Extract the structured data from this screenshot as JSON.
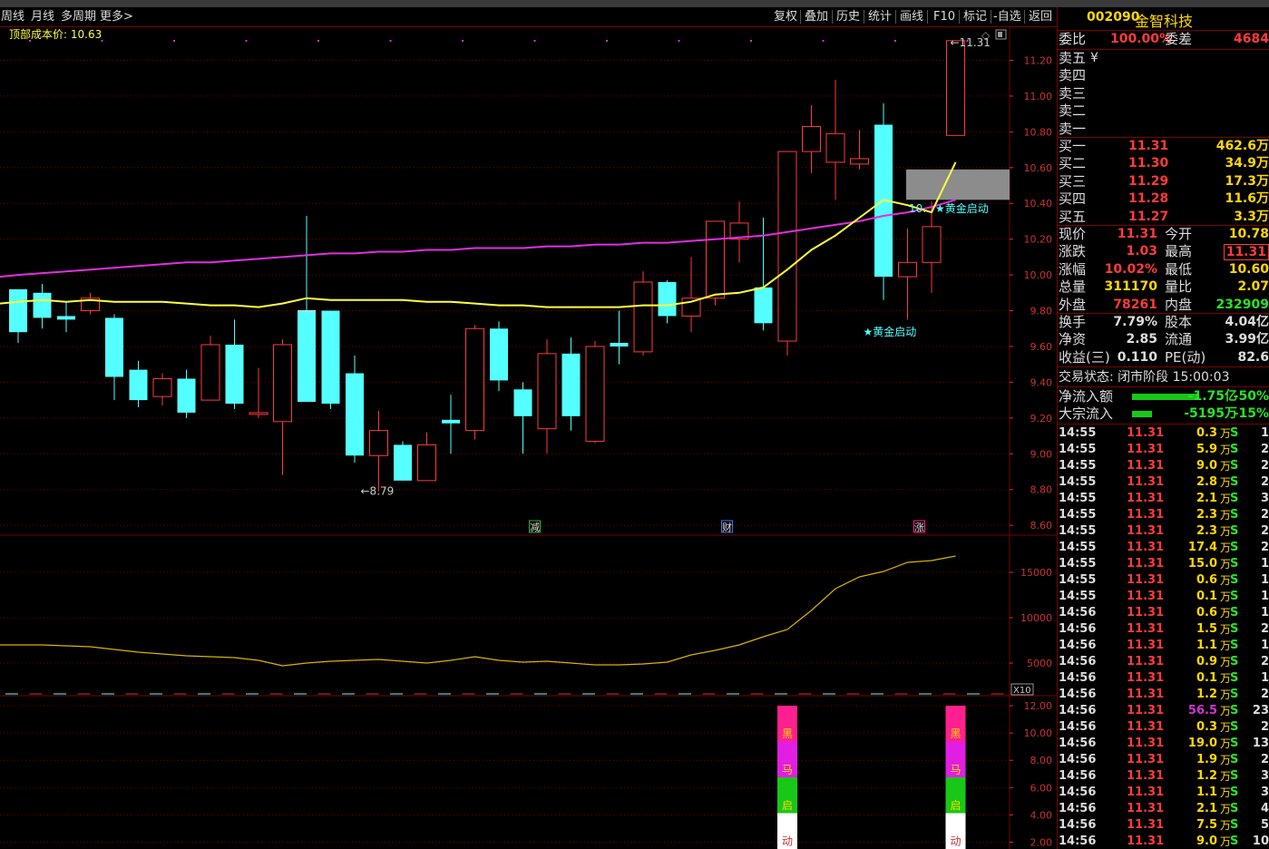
{
  "toolbar": {
    "left": [
      "周线",
      "月线",
      "多周期",
      "更多"
    ],
    "right": [
      "复权",
      "叠加",
      "历史",
      "统计",
      "画线",
      "F10",
      "标记",
      "-自选",
      "返回"
    ]
  },
  "chart": {
    "top_cost_label": "顶部成本价: 10.63",
    "price_ticks": [
      "11.20",
      "11.00",
      "10.80",
      "10.60",
      "10.40",
      "10.20",
      "10.00",
      "9.80",
      "9.60",
      "9.40",
      "9.20",
      "9.00",
      "8.80",
      "8.60"
    ],
    "high_marker": "11.31",
    "low_marker": "8.79",
    "signal_label": "★黄金启动",
    "signal_label_right": "★黄金启动",
    "signal_prefix": "10.",
    "event_markers": [
      "减",
      "财",
      "涨"
    ],
    "vol_ticks": [
      "15000",
      "10000",
      "5000"
    ],
    "vol_unit": "X10",
    "ind_ticks": [
      "12.00",
      "10.00",
      "8.00",
      "6.00",
      "4.00",
      "2.00"
    ],
    "ind_chars": [
      "黑",
      "马",
      "启",
      "动"
    ],
    "colors": {
      "up": "#ff3b3b",
      "down": "#54ffff",
      "ma5": "#ffff3c",
      "ma_long": "#e22ee2",
      "grid": "#7a0000"
    }
  },
  "chart_data": {
    "type": "candlestick",
    "candles": [
      {
        "o": 9.92,
        "c": 9.68,
        "h": 9.92,
        "l": 9.62
      },
      {
        "o": 9.9,
        "c": 9.76,
        "h": 9.95,
        "l": 9.7
      },
      {
        "o": 9.77,
        "c": 9.75,
        "h": 9.85,
        "l": 9.68
      },
      {
        "o": 9.8,
        "c": 9.87,
        "h": 9.9,
        "l": 9.78
      },
      {
        "o": 9.76,
        "c": 9.43,
        "h": 9.78,
        "l": 9.3
      },
      {
        "o": 9.47,
        "c": 9.3,
        "h": 9.52,
        "l": 9.26
      },
      {
        "o": 9.32,
        "c": 9.42,
        "h": 9.45,
        "l": 9.27
      },
      {
        "o": 9.42,
        "c": 9.23,
        "h": 9.47,
        "l": 9.2
      },
      {
        "o": 9.3,
        "c": 9.61,
        "h": 9.66,
        "l": 9.3
      },
      {
        "o": 9.61,
        "c": 9.28,
        "h": 9.75,
        "l": 9.25
      },
      {
        "o": 9.22,
        "c": 9.23,
        "h": 9.48,
        "l": 9.2
      },
      {
        "o": 9.18,
        "c": 9.61,
        "h": 9.64,
        "l": 8.88
      },
      {
        "o": 9.8,
        "c": 9.29,
        "h": 10.33,
        "l": 9.7
      },
      {
        "o": 9.8,
        "c": 9.28,
        "h": 9.8,
        "l": 9.25
      },
      {
        "o": 9.45,
        "c": 8.99,
        "h": 9.55,
        "l": 8.95
      },
      {
        "o": 8.99,
        "c": 9.13,
        "h": 9.24,
        "l": 8.79
      },
      {
        "o": 9.05,
        "c": 8.85,
        "h": 9.07,
        "l": 8.85
      },
      {
        "o": 8.85,
        "c": 9.05,
        "h": 9.12,
        "l": 8.85
      },
      {
        "o": 9.19,
        "c": 9.17,
        "h": 9.33,
        "l": 9.0
      },
      {
        "o": 9.13,
        "c": 9.7,
        "h": 9.72,
        "l": 9.08
      },
      {
        "o": 9.7,
        "c": 9.41,
        "h": 9.74,
        "l": 9.35
      },
      {
        "o": 9.36,
        "c": 9.21,
        "h": 9.4,
        "l": 9.0
      },
      {
        "o": 9.14,
        "c": 9.56,
        "h": 9.64,
        "l": 9.0
      },
      {
        "o": 9.56,
        "c": 9.21,
        "h": 9.65,
        "l": 9.13
      },
      {
        "o": 9.07,
        "c": 9.6,
        "h": 9.63,
        "l": 9.06
      },
      {
        "o": 9.62,
        "c": 9.6,
        "h": 9.8,
        "l": 9.5
      },
      {
        "o": 9.57,
        "c": 9.96,
        "h": 10.02,
        "l": 9.55
      },
      {
        "o": 9.96,
        "c": 9.77,
        "h": 9.97,
        "l": 9.73
      },
      {
        "o": 9.77,
        "c": 9.87,
        "h": 10.1,
        "l": 9.68
      },
      {
        "o": 9.87,
        "c": 10.3,
        "h": 10.3,
        "l": 9.83
      },
      {
        "o": 10.2,
        "c": 10.29,
        "h": 10.41,
        "l": 10.07
      },
      {
        "o": 9.93,
        "c": 9.73,
        "h": 10.32,
        "l": 9.69
      },
      {
        "o": 9.63,
        "c": 10.69,
        "h": 10.69,
        "l": 9.55
      },
      {
        "o": 10.69,
        "c": 10.83,
        "h": 10.95,
        "l": 10.57
      },
      {
        "o": 10.63,
        "c": 10.79,
        "h": 11.09,
        "l": 10.42
      },
      {
        "o": 10.62,
        "c": 10.65,
        "h": 10.81,
        "l": 10.59
      },
      {
        "o": 10.84,
        "c": 9.99,
        "h": 10.96,
        "l": 9.86
      },
      {
        "o": 9.99,
        "c": 10.07,
        "h": 10.26,
        "l": 9.75
      },
      {
        "o": 10.07,
        "c": 10.27,
        "h": 10.41,
        "l": 9.9
      },
      {
        "o": 10.78,
        "c": 11.31,
        "h": 11.31,
        "l": 10.78
      }
    ],
    "ma_short": [
      9.85,
      9.86,
      9.85,
      9.86,
      9.85,
      9.85,
      9.85,
      9.84,
      9.83,
      9.83,
      9.82,
      9.84,
      9.87,
      9.86,
      9.86,
      9.86,
      9.86,
      9.85,
      9.85,
      9.84,
      9.83,
      9.83,
      9.82,
      9.82,
      9.82,
      9.82,
      9.83,
      9.83,
      9.85,
      9.89,
      9.9,
      9.93,
      10.03,
      10.14,
      10.22,
      10.32,
      10.42,
      10.39,
      10.35,
      10.63
    ],
    "ma_long": [
      10.0,
      10.01,
      10.02,
      10.03,
      10.04,
      10.05,
      10.06,
      10.07,
      10.07,
      10.08,
      10.09,
      10.1,
      10.11,
      10.12,
      10.12,
      10.13,
      10.13,
      10.14,
      10.14,
      10.15,
      10.15,
      10.15,
      10.16,
      10.16,
      10.17,
      10.17,
      10.18,
      10.18,
      10.19,
      10.2,
      10.21,
      10.22,
      10.24,
      10.26,
      10.28,
      10.3,
      10.33,
      10.35,
      10.38,
      10.42
    ],
    "volume_line": [
      7000,
      7000,
      6900,
      6800,
      6500,
      6200,
      6000,
      5800,
      5700,
      5600,
      5300,
      4700,
      5000,
      5200,
      5300,
      5400,
      5200,
      5000,
      5300,
      5700,
      5300,
      5100,
      5200,
      5000,
      4800,
      4800,
      4900,
      5100,
      5900,
      6400,
      7000,
      7900,
      8700,
      10800,
      13200,
      14500,
      15100,
      16100,
      16300,
      16800
    ],
    "indicator_bars": [
      {
        "index": 32,
        "value": 12.0
      },
      {
        "index": 39,
        "value": 12.0
      }
    ],
    "price_ylim": [
      8.55,
      11.38
    ],
    "volume_ylim": [
      1500,
      19000
    ],
    "indicator_ylim": [
      1.5,
      12.6
    ]
  },
  "panel": {
    "code": "002090",
    "name": "金智科技",
    "weibi_label": "委比",
    "weibi_value": "100.00%",
    "weicha_label": "委差",
    "weicha_value": "4684",
    "sells": [
      {
        "label": "卖五"
      },
      {
        "label": "卖四"
      },
      {
        "label": "卖三"
      },
      {
        "label": "卖二"
      },
      {
        "label": "卖一"
      }
    ],
    "yen_mark": "¥",
    "buys": [
      {
        "label": "买一",
        "price": "11.31",
        "vol": "462.6万"
      },
      {
        "label": "买二",
        "price": "11.30",
        "vol": "34.9万"
      },
      {
        "label": "买三",
        "price": "11.29",
        "vol": "17.3万"
      },
      {
        "label": "买四",
        "price": "11.28",
        "vol": "11.6万"
      },
      {
        "label": "买五",
        "price": "11.27",
        "vol": "3.3万"
      }
    ],
    "quote": [
      {
        "l1": "现价",
        "v1": "11.31",
        "l2": "今开",
        "v2": "10.78"
      },
      {
        "l1": "涨跌",
        "v1": "1.03",
        "l2": "最高",
        "v2": "11.31"
      },
      {
        "l1": "涨幅",
        "v1": "10.02%",
        "l2": "最低",
        "v2": "10.60"
      },
      {
        "l1": "总量",
        "v1": "311170",
        "l2": "量比",
        "v2": "2.07"
      },
      {
        "l1": "外盘",
        "v1": "78261",
        "l2": "内盘",
        "v2": "232909"
      }
    ],
    "stats": [
      {
        "l1": "换手",
        "v1": "7.79%",
        "l2": "股本",
        "v2": "4.04亿"
      },
      {
        "l1": "净资",
        "v1": "2.85",
        "l2": "流通",
        "v2": "3.99亿"
      },
      {
        "l1": "收益(三)",
        "v1": "0.110",
        "l2": "PE(动)",
        "v2": "82.6"
      }
    ],
    "trade_status": "交易状态: 闭市阶段 15:00:03",
    "flows": [
      {
        "label": "净流入额",
        "value": "-1.75亿",
        "pct": "-50%",
        "bar": 0.5
      },
      {
        "label": "大宗流入",
        "value": "-5195万",
        "pct": "-15%",
        "bar": 0.15
      }
    ],
    "ticks": [
      {
        "t": "14:55",
        "p": "11.31",
        "v": "0.3",
        "s": "S",
        "n": "1"
      },
      {
        "t": "14:55",
        "p": "11.31",
        "v": "5.9",
        "s": "S",
        "n": "2"
      },
      {
        "t": "14:55",
        "p": "11.31",
        "v": "9.0",
        "s": "S",
        "n": "2"
      },
      {
        "t": "14:55",
        "p": "11.31",
        "v": "2.8",
        "s": "S",
        "n": "2"
      },
      {
        "t": "14:55",
        "p": "11.31",
        "v": "2.1",
        "s": "S",
        "n": "3"
      },
      {
        "t": "14:55",
        "p": "11.31",
        "v": "2.3",
        "s": "S",
        "n": "2"
      },
      {
        "t": "14:55",
        "p": "11.31",
        "v": "2.3",
        "s": "S",
        "n": "2"
      },
      {
        "t": "14:55",
        "p": "11.31",
        "v": "17.4",
        "s": "S",
        "n": "2"
      },
      {
        "t": "14:55",
        "p": "11.31",
        "v": "15.0",
        "s": "S",
        "n": "1"
      },
      {
        "t": "14:55",
        "p": "11.31",
        "v": "0.6",
        "s": "S",
        "n": "1"
      },
      {
        "t": "14:55",
        "p": "11.31",
        "v": "0.1",
        "s": "S",
        "n": "1"
      },
      {
        "t": "14:56",
        "p": "11.31",
        "v": "0.6",
        "s": "S",
        "n": "1"
      },
      {
        "t": "14:56",
        "p": "11.31",
        "v": "1.5",
        "s": "S",
        "n": "2"
      },
      {
        "t": "14:56",
        "p": "11.31",
        "v": "1.1",
        "s": "S",
        "n": "1"
      },
      {
        "t": "14:56",
        "p": "11.31",
        "v": "0.9",
        "s": "S",
        "n": "2"
      },
      {
        "t": "14:56",
        "p": "11.31",
        "v": "0.1",
        "s": "S",
        "n": "1"
      },
      {
        "t": "14:56",
        "p": "11.31",
        "v": "1.2",
        "s": "S",
        "n": "2"
      },
      {
        "t": "14:56",
        "p": "11.31",
        "v": "56.5",
        "s": "S",
        "n": "23"
      },
      {
        "t": "14:56",
        "p": "11.31",
        "v": "0.3",
        "s": "S",
        "n": "2"
      },
      {
        "t": "14:56",
        "p": "11.31",
        "v": "19.0",
        "s": "S",
        "n": "13"
      },
      {
        "t": "14:56",
        "p": "11.31",
        "v": "1.9",
        "s": "S",
        "n": "2"
      },
      {
        "t": "14:56",
        "p": "11.31",
        "v": "1.2",
        "s": "S",
        "n": "3"
      },
      {
        "t": "14:56",
        "p": "11.31",
        "v": "1.1",
        "s": "S",
        "n": "3"
      },
      {
        "t": "14:56",
        "p": "11.31",
        "v": "2.1",
        "s": "S",
        "n": "4"
      },
      {
        "t": "14:56",
        "p": "11.31",
        "v": "7.5",
        "s": "S",
        "n": "5"
      },
      {
        "t": "14:56",
        "p": "11.31",
        "v": "9.0",
        "s": "S",
        "n": "10"
      }
    ],
    "wan": "万"
  }
}
